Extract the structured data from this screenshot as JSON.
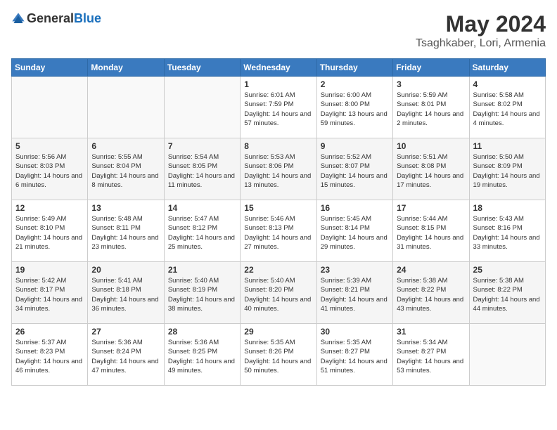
{
  "header": {
    "logo_general": "General",
    "logo_blue": "Blue",
    "month": "May 2024",
    "location": "Tsaghkaber, Lori, Armenia"
  },
  "weekdays": [
    "Sunday",
    "Monday",
    "Tuesday",
    "Wednesday",
    "Thursday",
    "Friday",
    "Saturday"
  ],
  "weeks": [
    [
      {
        "day": "",
        "sunrise": "",
        "sunset": "",
        "daylight": ""
      },
      {
        "day": "",
        "sunrise": "",
        "sunset": "",
        "daylight": ""
      },
      {
        "day": "",
        "sunrise": "",
        "sunset": "",
        "daylight": ""
      },
      {
        "day": "1",
        "sunrise": "Sunrise: 6:01 AM",
        "sunset": "Sunset: 7:59 PM",
        "daylight": "Daylight: 14 hours and 57 minutes."
      },
      {
        "day": "2",
        "sunrise": "Sunrise: 6:00 AM",
        "sunset": "Sunset: 8:00 PM",
        "daylight": "Daylight: 13 hours and 59 minutes."
      },
      {
        "day": "3",
        "sunrise": "Sunrise: 5:59 AM",
        "sunset": "Sunset: 8:01 PM",
        "daylight": "Daylight: 14 hours and 2 minutes."
      },
      {
        "day": "4",
        "sunrise": "Sunrise: 5:58 AM",
        "sunset": "Sunset: 8:02 PM",
        "daylight": "Daylight: 14 hours and 4 minutes."
      }
    ],
    [
      {
        "day": "5",
        "sunrise": "Sunrise: 5:56 AM",
        "sunset": "Sunset: 8:03 PM",
        "daylight": "Daylight: 14 hours and 6 minutes."
      },
      {
        "day": "6",
        "sunrise": "Sunrise: 5:55 AM",
        "sunset": "Sunset: 8:04 PM",
        "daylight": "Daylight: 14 hours and 8 minutes."
      },
      {
        "day": "7",
        "sunrise": "Sunrise: 5:54 AM",
        "sunset": "Sunset: 8:05 PM",
        "daylight": "Daylight: 14 hours and 11 minutes."
      },
      {
        "day": "8",
        "sunrise": "Sunrise: 5:53 AM",
        "sunset": "Sunset: 8:06 PM",
        "daylight": "Daylight: 14 hours and 13 minutes."
      },
      {
        "day": "9",
        "sunrise": "Sunrise: 5:52 AM",
        "sunset": "Sunset: 8:07 PM",
        "daylight": "Daylight: 14 hours and 15 minutes."
      },
      {
        "day": "10",
        "sunrise": "Sunrise: 5:51 AM",
        "sunset": "Sunset: 8:08 PM",
        "daylight": "Daylight: 14 hours and 17 minutes."
      },
      {
        "day": "11",
        "sunrise": "Sunrise: 5:50 AM",
        "sunset": "Sunset: 8:09 PM",
        "daylight": "Daylight: 14 hours and 19 minutes."
      }
    ],
    [
      {
        "day": "12",
        "sunrise": "Sunrise: 5:49 AM",
        "sunset": "Sunset: 8:10 PM",
        "daylight": "Daylight: 14 hours and 21 minutes."
      },
      {
        "day": "13",
        "sunrise": "Sunrise: 5:48 AM",
        "sunset": "Sunset: 8:11 PM",
        "daylight": "Daylight: 14 hours and 23 minutes."
      },
      {
        "day": "14",
        "sunrise": "Sunrise: 5:47 AM",
        "sunset": "Sunset: 8:12 PM",
        "daylight": "Daylight: 14 hours and 25 minutes."
      },
      {
        "day": "15",
        "sunrise": "Sunrise: 5:46 AM",
        "sunset": "Sunset: 8:13 PM",
        "daylight": "Daylight: 14 hours and 27 minutes."
      },
      {
        "day": "16",
        "sunrise": "Sunrise: 5:45 AM",
        "sunset": "Sunset: 8:14 PM",
        "daylight": "Daylight: 14 hours and 29 minutes."
      },
      {
        "day": "17",
        "sunrise": "Sunrise: 5:44 AM",
        "sunset": "Sunset: 8:15 PM",
        "daylight": "Daylight: 14 hours and 31 minutes."
      },
      {
        "day": "18",
        "sunrise": "Sunrise: 5:43 AM",
        "sunset": "Sunset: 8:16 PM",
        "daylight": "Daylight: 14 hours and 33 minutes."
      }
    ],
    [
      {
        "day": "19",
        "sunrise": "Sunrise: 5:42 AM",
        "sunset": "Sunset: 8:17 PM",
        "daylight": "Daylight: 14 hours and 34 minutes."
      },
      {
        "day": "20",
        "sunrise": "Sunrise: 5:41 AM",
        "sunset": "Sunset: 8:18 PM",
        "daylight": "Daylight: 14 hours and 36 minutes."
      },
      {
        "day": "21",
        "sunrise": "Sunrise: 5:40 AM",
        "sunset": "Sunset: 8:19 PM",
        "daylight": "Daylight: 14 hours and 38 minutes."
      },
      {
        "day": "22",
        "sunrise": "Sunrise: 5:40 AM",
        "sunset": "Sunset: 8:20 PM",
        "daylight": "Daylight: 14 hours and 40 minutes."
      },
      {
        "day": "23",
        "sunrise": "Sunrise: 5:39 AM",
        "sunset": "Sunset: 8:21 PM",
        "daylight": "Daylight: 14 hours and 41 minutes."
      },
      {
        "day": "24",
        "sunrise": "Sunrise: 5:38 AM",
        "sunset": "Sunset: 8:22 PM",
        "daylight": "Daylight: 14 hours and 43 minutes."
      },
      {
        "day": "25",
        "sunrise": "Sunrise: 5:38 AM",
        "sunset": "Sunset: 8:22 PM",
        "daylight": "Daylight: 14 hours and 44 minutes."
      }
    ],
    [
      {
        "day": "26",
        "sunrise": "Sunrise: 5:37 AM",
        "sunset": "Sunset: 8:23 PM",
        "daylight": "Daylight: 14 hours and 46 minutes."
      },
      {
        "day": "27",
        "sunrise": "Sunrise: 5:36 AM",
        "sunset": "Sunset: 8:24 PM",
        "daylight": "Daylight: 14 hours and 47 minutes."
      },
      {
        "day": "28",
        "sunrise": "Sunrise: 5:36 AM",
        "sunset": "Sunset: 8:25 PM",
        "daylight": "Daylight: 14 hours and 49 minutes."
      },
      {
        "day": "29",
        "sunrise": "Sunrise: 5:35 AM",
        "sunset": "Sunset: 8:26 PM",
        "daylight": "Daylight: 14 hours and 50 minutes."
      },
      {
        "day": "30",
        "sunrise": "Sunrise: 5:35 AM",
        "sunset": "Sunset: 8:27 PM",
        "daylight": "Daylight: 14 hours and 51 minutes."
      },
      {
        "day": "31",
        "sunrise": "Sunrise: 5:34 AM",
        "sunset": "Sunset: 8:27 PM",
        "daylight": "Daylight: 14 hours and 53 minutes."
      },
      {
        "day": "",
        "sunrise": "",
        "sunset": "",
        "daylight": ""
      }
    ]
  ]
}
